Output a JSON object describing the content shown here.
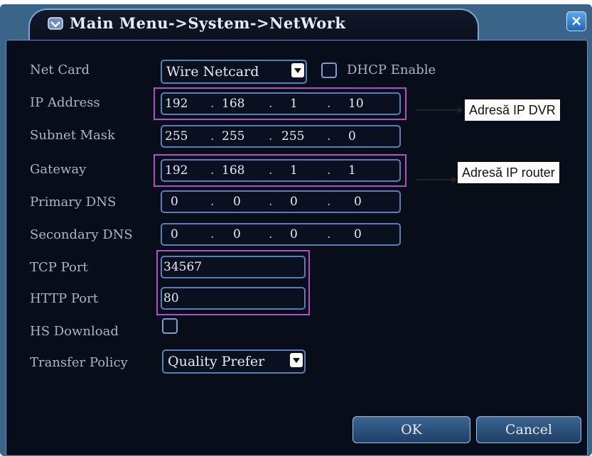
{
  "window": {
    "title": "Main Menu->System->NetWork"
  },
  "fields": {
    "net_card": {
      "label": "Net Card",
      "value": "Wire Netcard"
    },
    "dhcp": {
      "label": "DHCP Enable",
      "checked": false
    },
    "ip_address": {
      "label": "IP Address",
      "octets": [
        "192",
        "168",
        "1",
        "10"
      ]
    },
    "subnet_mask": {
      "label": "Subnet Mask",
      "octets": [
        "255",
        "255",
        "255",
        "0"
      ]
    },
    "gateway": {
      "label": "Gateway",
      "octets": [
        "192",
        "168",
        "1",
        "1"
      ]
    },
    "primary_dns": {
      "label": "Primary DNS",
      "octets": [
        "0",
        "0",
        "0",
        "0"
      ]
    },
    "secondary_dns": {
      "label": "Secondary DNS",
      "octets": [
        "0",
        "0",
        "0",
        "0"
      ]
    },
    "tcp_port": {
      "label": "TCP Port",
      "value": "34567"
    },
    "http_port": {
      "label": "HTTP Port",
      "value": "80"
    },
    "hs_download": {
      "label": "HS Download",
      "checked": false
    },
    "transfer_policy": {
      "label": "Transfer Policy",
      "value": "Quality Prefer"
    }
  },
  "buttons": {
    "ok": "OK",
    "cancel": "Cancel"
  },
  "annotations": {
    "dvr_ip": "Adresă IP DVR",
    "router_ip": "Adresă IP router"
  },
  "colors": {
    "panel": "#080d1a",
    "frame": "#3a6488",
    "field_border": "#5b7fb4",
    "highlight": "#b04fc8"
  },
  "icons": {
    "title": "menu-icon",
    "close": "close-icon",
    "dropdown": "chevron-down-icon"
  }
}
